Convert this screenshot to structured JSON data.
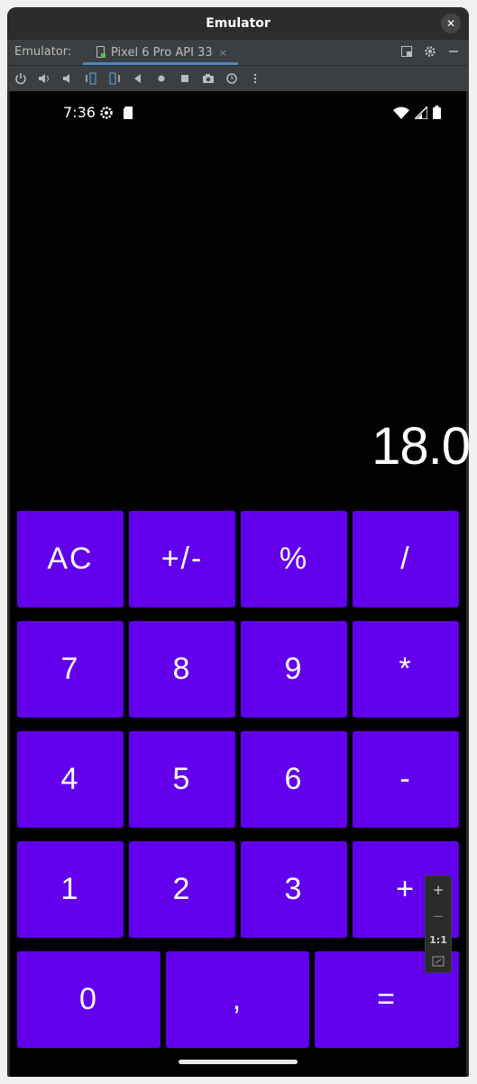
{
  "window": {
    "title": "Emulator",
    "close_glyph": "✕"
  },
  "tabbar": {
    "label": "Emulator:",
    "tab_title": "Pixel 6 Pro API 33",
    "tab_close": "×",
    "accent": "#4a88c7"
  },
  "toolbar": {
    "icons": [
      "power-icon",
      "volume-up-icon",
      "volume-down-icon",
      "rotate-left-icon",
      "rotate-right-icon",
      "back-icon",
      "home-icon",
      "overview-icon",
      "screenshot-icon",
      "snapshot-icon",
      "more-icon"
    ]
  },
  "status": {
    "time": "7:36"
  },
  "calculator": {
    "display": "18.0",
    "key_color": "#6200ee",
    "rows": [
      [
        "AC",
        "+/-",
        "%",
        "/"
      ],
      [
        "7",
        "8",
        "9",
        "*"
      ],
      [
        "4",
        "5",
        "6",
        "-"
      ],
      [
        "1",
        "2",
        "3",
        "+"
      ],
      [
        "0",
        ",",
        "="
      ]
    ]
  },
  "zoom": {
    "plus": "+",
    "minus": "−",
    "ratio": "1:1"
  }
}
